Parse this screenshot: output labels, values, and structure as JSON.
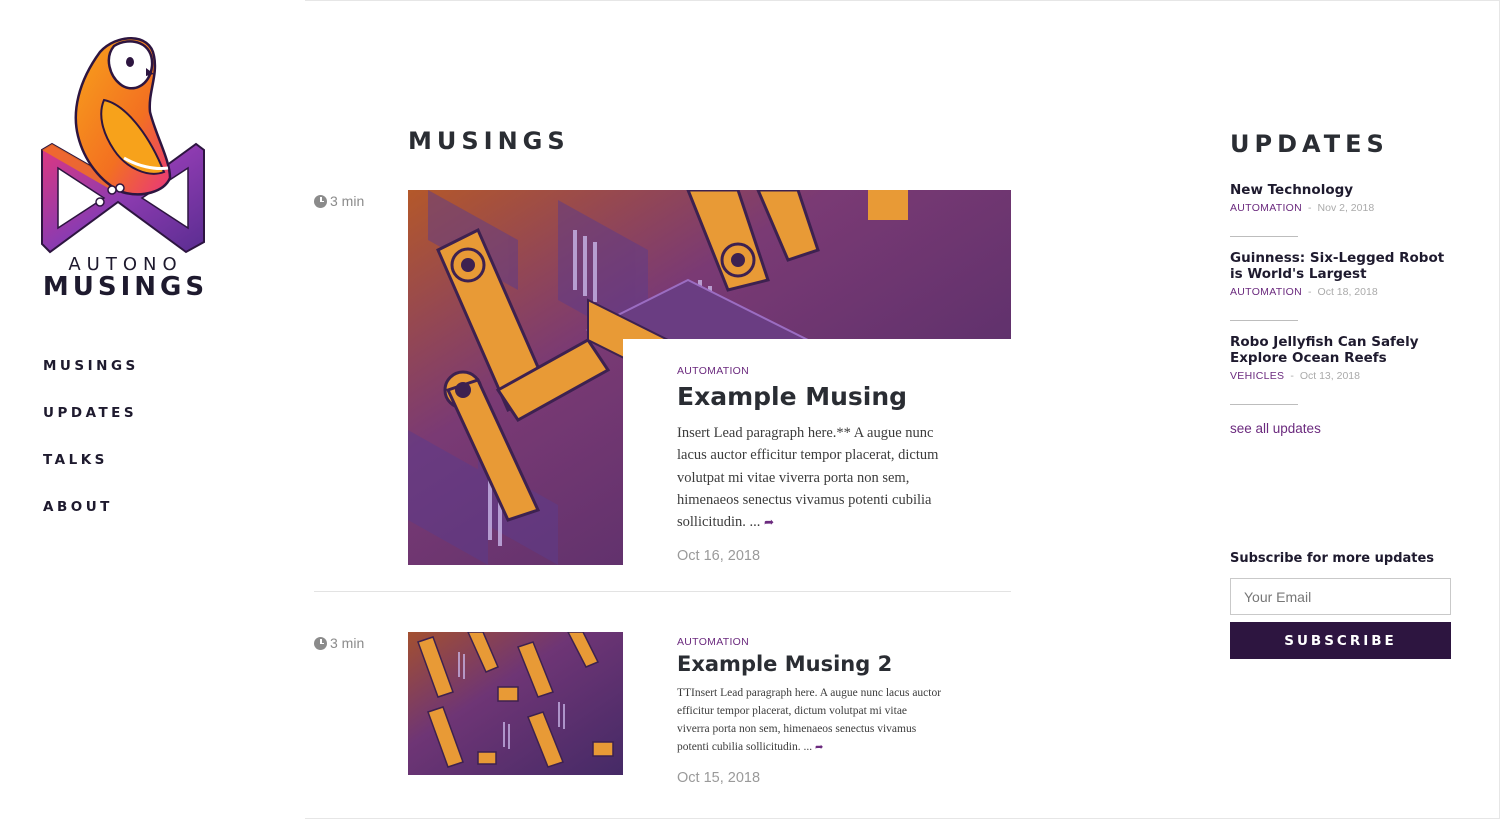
{
  "brand": {
    "line1": "AUTONO",
    "line2": "MUSINGS"
  },
  "nav": [
    {
      "label": "MUSINGS"
    },
    {
      "label": "UPDATES"
    },
    {
      "label": "TALKS"
    },
    {
      "label": "ABOUT"
    }
  ],
  "main": {
    "title": "MUSINGS",
    "posts": [
      {
        "read_time": "3 min",
        "category": "AUTOMATION",
        "title": "Example Musing",
        "lead": "Insert Lead paragraph here.** A augue nunc lacus auctor efficitur tempor placerat, dictum volutpat mi vitae viverra porta non sem, himenaeos senectus vivamus potenti cubilia sollicitudin. ...",
        "date": "Oct 16, 2018"
      },
      {
        "read_time": "3 min",
        "category": "AUTOMATION",
        "title": "Example Musing 2",
        "lead": "TTInsert Lead paragraph here. A augue nunc lacus auctor efficitur tempor placerat, dictum volutpat mi vitae viverra porta non sem, himenaeos senectus vivamus potenti cubilia sollicitudin. ...",
        "date": "Oct 15, 2018"
      }
    ]
  },
  "updates": {
    "title": "UPDATES",
    "items": [
      {
        "title": "New Technology",
        "category": "AUTOMATION",
        "separator": "-",
        "date": "Nov 2, 2018"
      },
      {
        "title": "Guinness: Six-Legged Robot is World's Largest",
        "category": "AUTOMATION",
        "separator": "-",
        "date": "Oct 18, 2018"
      },
      {
        "title": "Robo Jellyfish Can Safely Explore Ocean Reefs",
        "category": "VEHICLES",
        "separator": "-",
        "date": "Oct 13, 2018"
      }
    ],
    "see_all": "see all updates"
  },
  "subscribe": {
    "label": "Subscribe for more updates",
    "email_placeholder": "Your Email",
    "button": "SUBSCRIBE"
  },
  "colors": {
    "accent": "#6b2a7e",
    "dark": "#2d1540",
    "text": "#2a2d33",
    "muted": "#9a9a9a"
  },
  "icons": {
    "read_time": "clock-icon",
    "read_more": "share-arrow-icon",
    "logo": "owl-logo-icon"
  }
}
